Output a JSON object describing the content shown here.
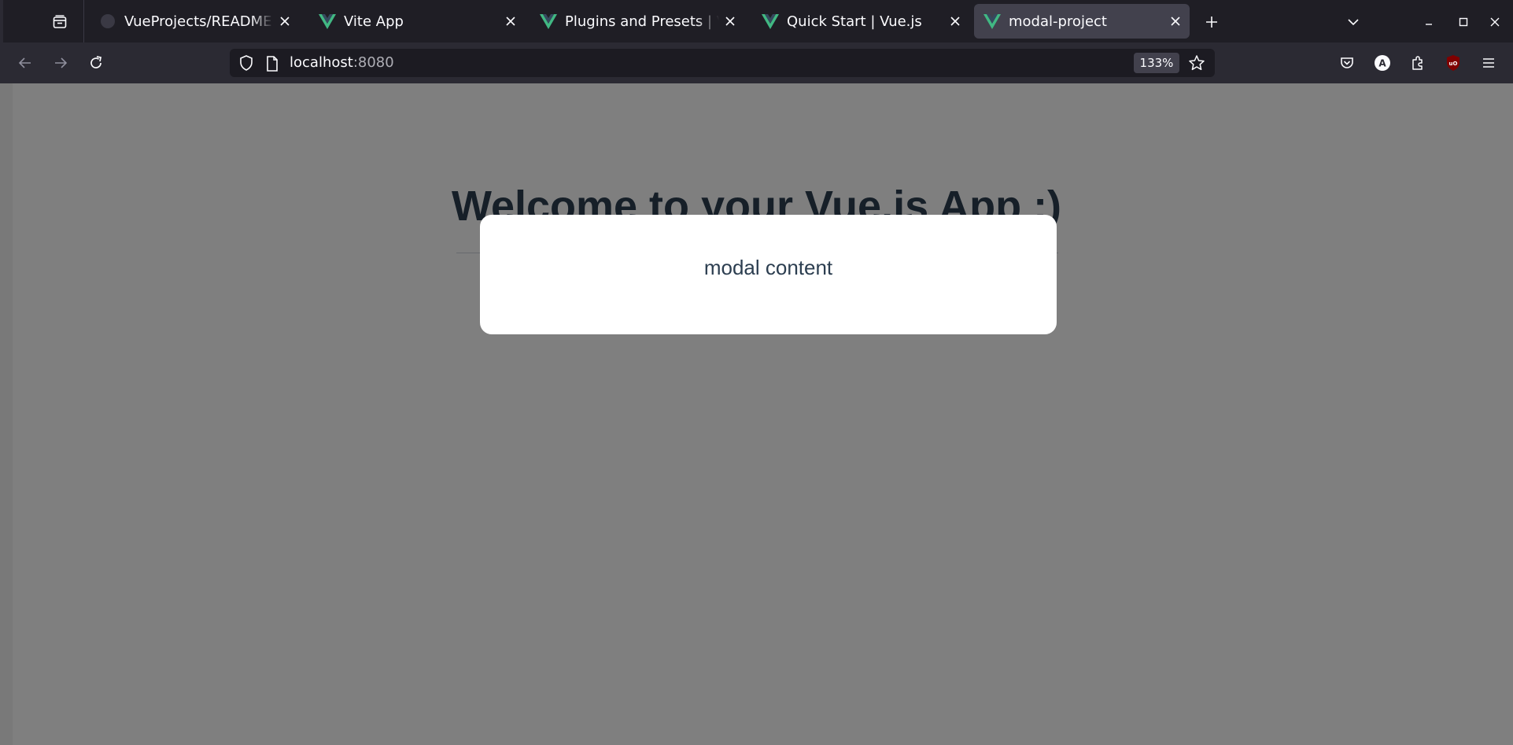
{
  "browser": {
    "tabs": [
      {
        "title": "VueProjects/README.md",
        "favicon": "github-icon",
        "active": false
      },
      {
        "title": "Vite App",
        "favicon": "vue-logo-icon",
        "active": false
      },
      {
        "title": "Plugins and Presets | Vue CLI",
        "favicon": "vue-logo-icon",
        "active": false
      },
      {
        "title": "Quick Start | Vue.js",
        "favicon": "vue-logo-icon",
        "active": false
      },
      {
        "title": "modal-project",
        "favicon": "vue-logo-icon",
        "active": true
      }
    ],
    "url_host": "localhost",
    "url_port": ":8080",
    "zoom": "133%"
  },
  "page": {
    "heading": "Welcome to your Vue.js App :)",
    "modal_text": "modal content"
  },
  "colors": {
    "vue_green": "#41b883",
    "text_dark": "#2c3e50",
    "backdrop": "rgba(0,0,0,0.5)",
    "ublock_red": "#800000"
  }
}
